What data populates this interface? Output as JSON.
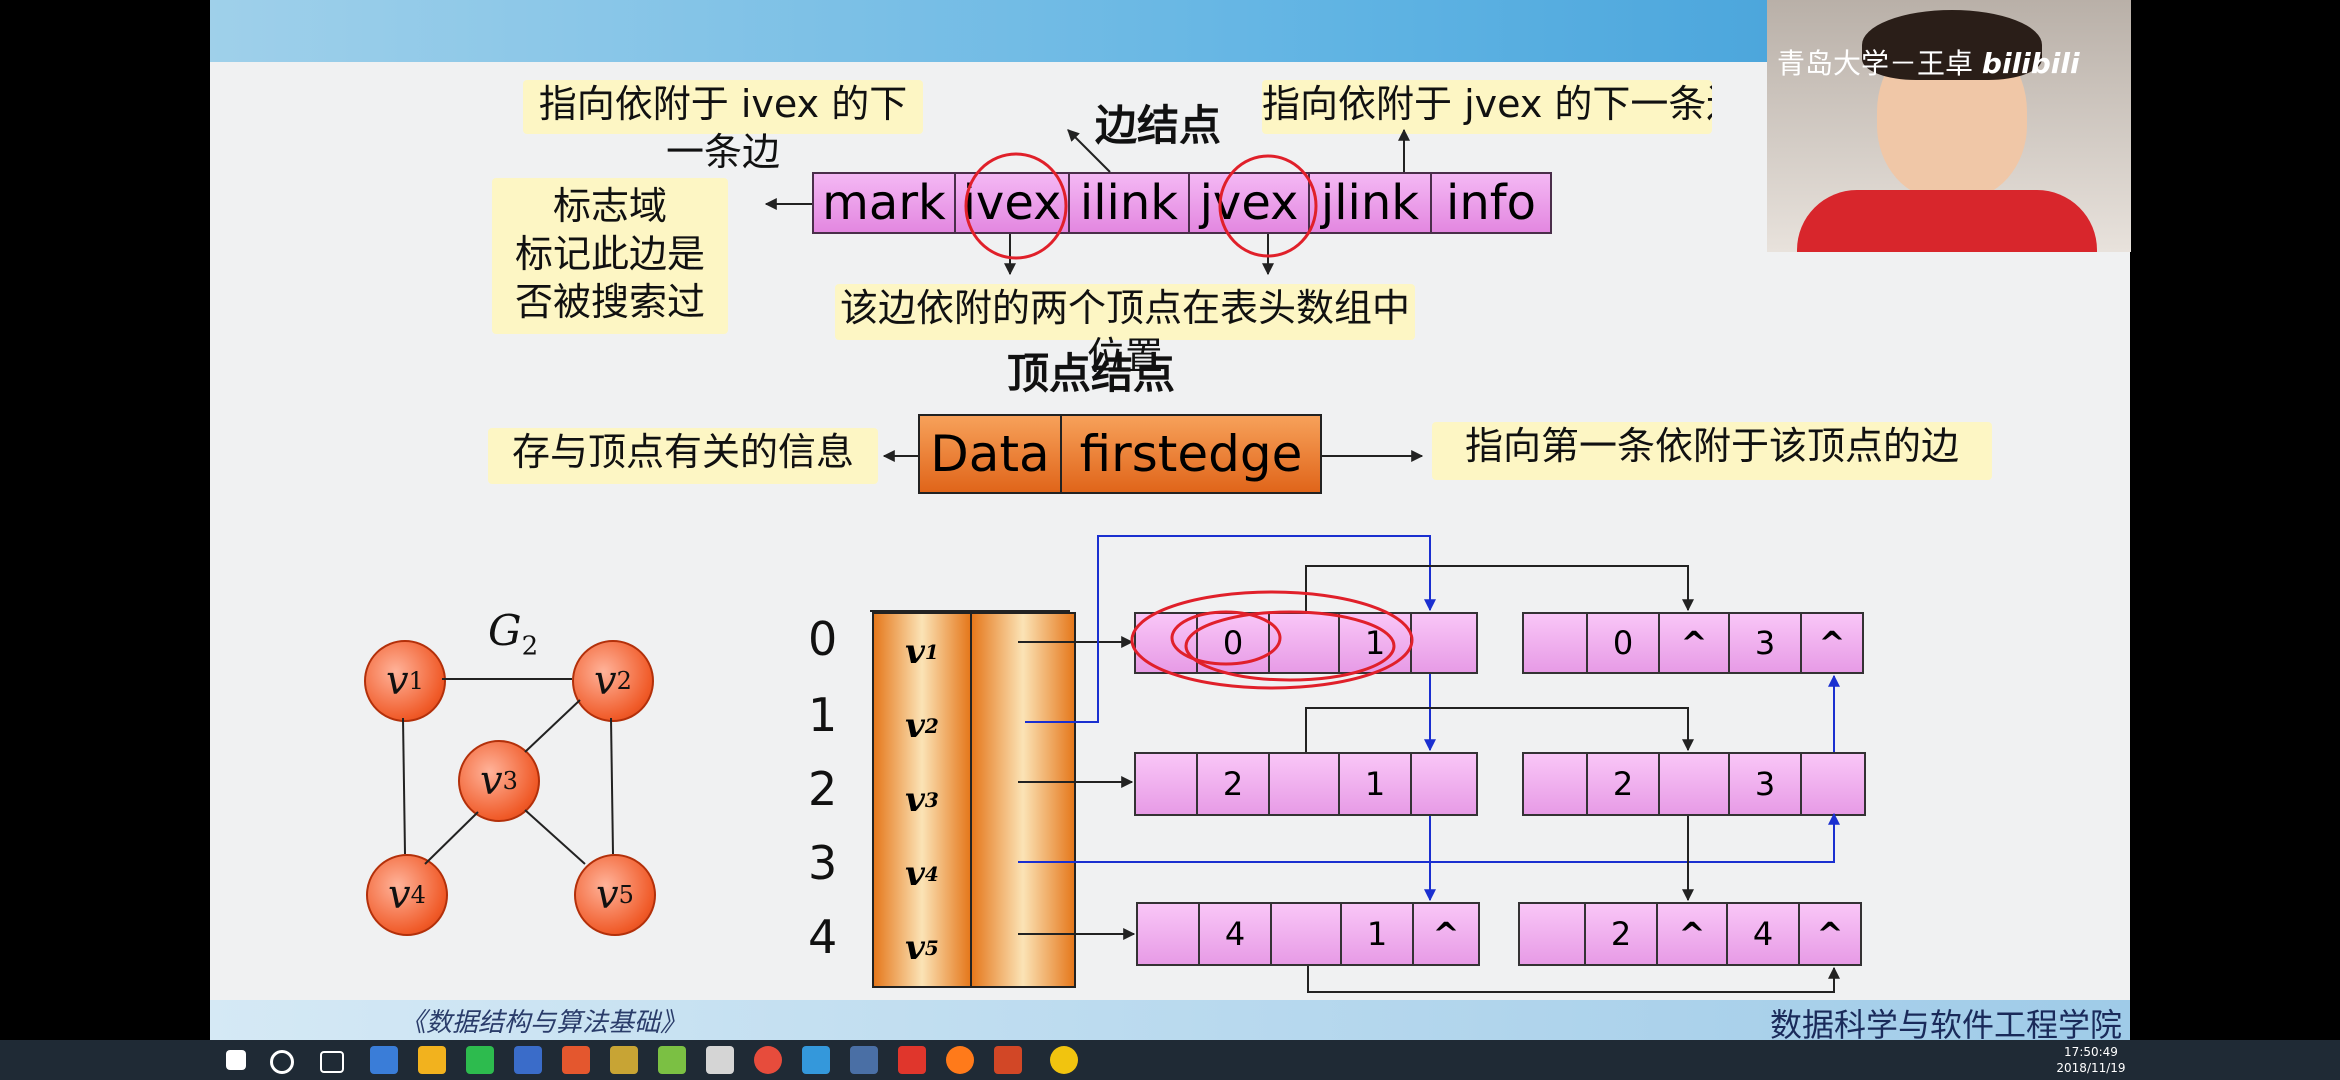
{
  "edge_node": {
    "title": "边结点",
    "fields": [
      "mark",
      "ivex",
      "ilink",
      "jvex",
      "jlink",
      "info"
    ],
    "note_ilink": "指向依附于 ivex 的下一条边",
    "note_jlink": "指向依附于 jvex 的下一条边",
    "note_mark": [
      "标志域",
      "标记此边是",
      "否被搜索过"
    ],
    "note_vex": "该边依附的两个顶点在表头数组中位置"
  },
  "vertex_node": {
    "title": "顶点结点",
    "fields": [
      "Data",
      "firstedge"
    ],
    "note_data": "存与顶点有关的信息",
    "note_firstedge": "指向第一条依附于该顶点的边"
  },
  "graph": {
    "name": "G",
    "name_sub": "2",
    "nodes": [
      {
        "label": "v",
        "sub": "1"
      },
      {
        "label": "v",
        "sub": "2"
      },
      {
        "label": "v",
        "sub": "3"
      },
      {
        "label": "v",
        "sub": "4"
      },
      {
        "label": "v",
        "sub": "5"
      }
    ]
  },
  "vertex_array": {
    "indices": [
      "0",
      "1",
      "2",
      "3",
      "4"
    ],
    "labels": [
      {
        "v": "v",
        "sub": "1"
      },
      {
        "v": "v",
        "sub": "2"
      },
      {
        "v": "v",
        "sub": "3"
      },
      {
        "v": "v",
        "sub": "4"
      },
      {
        "v": "v",
        "sub": "5"
      }
    ]
  },
  "edge_lists": [
    {
      "cells": [
        "",
        "0",
        "",
        "1",
        ""
      ]
    },
    {
      "cells": [
        "",
        "0",
        "^",
        "3",
        "^"
      ]
    },
    {
      "cells": [
        "",
        "2",
        "",
        "1",
        ""
      ]
    },
    {
      "cells": [
        "",
        "2",
        "",
        "3",
        ""
      ]
    },
    {
      "cells": [
        "",
        "4",
        "",
        "1",
        "^"
      ]
    },
    {
      "cells": [
        "",
        "2",
        "^",
        "4",
        "^"
      ]
    }
  ],
  "video": {
    "watermark": "青岛大学－王卓",
    "brand": "bilibili"
  },
  "footer": {
    "left_text": "《数据结构与算法基础》",
    "right_text": "数据科学与软件工程学院"
  },
  "taskbar": {
    "time": "17:50:49",
    "date": "2018/11/19"
  },
  "colors": {
    "annotation_red": "#e0202a",
    "pointer_blue": "#1a2fd0"
  }
}
